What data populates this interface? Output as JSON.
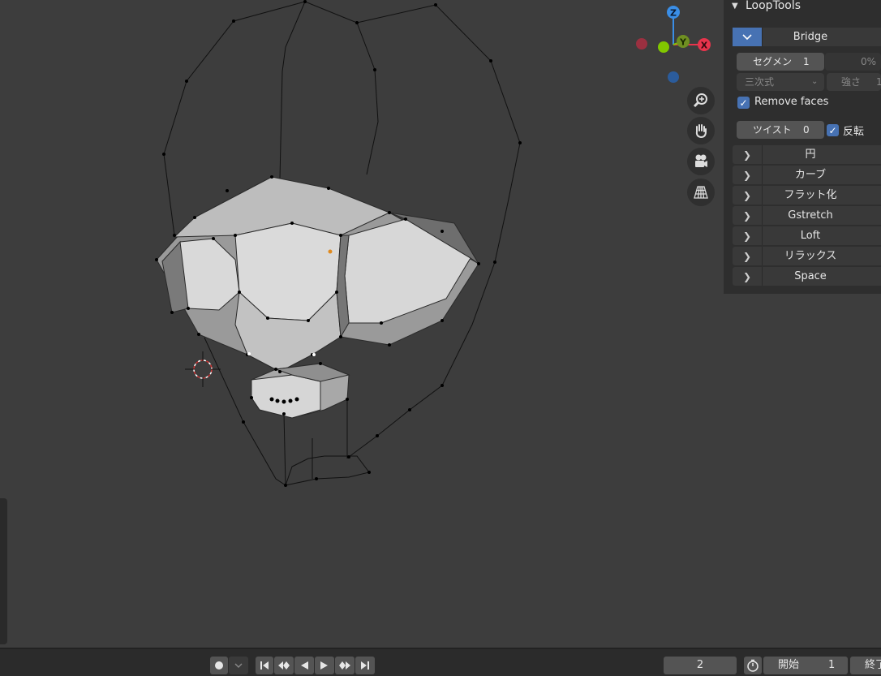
{
  "panel": {
    "title": "LoopTools",
    "bridge": {
      "label": "Bridge"
    },
    "segments": {
      "label": "セグメン",
      "value": "1",
      "percent": "0%"
    },
    "interpolation": {
      "value": "三次式"
    },
    "strength": {
      "label": "強さ",
      "value": "1"
    },
    "remove_faces": {
      "label": "Remove faces",
      "checked": true
    },
    "twist": {
      "label": "ツイスト",
      "value": "0"
    },
    "reverse": {
      "label": "反転",
      "checked": true
    },
    "tools": [
      "円",
      "カーブ",
      "フラット化",
      "Gstretch",
      "Loft",
      "リラックス",
      "Space"
    ]
  },
  "gizmo": {
    "z": "Z",
    "y": "Y",
    "x": "X"
  },
  "timeline": {
    "current_frame": "2",
    "start_label": "開始",
    "start_value": "1",
    "end_label": "終了"
  },
  "colors": {
    "accent": "#4772b3",
    "x_axis": "#e8344c",
    "y_axis": "#81c700",
    "z_axis": "#3a8ee6"
  }
}
